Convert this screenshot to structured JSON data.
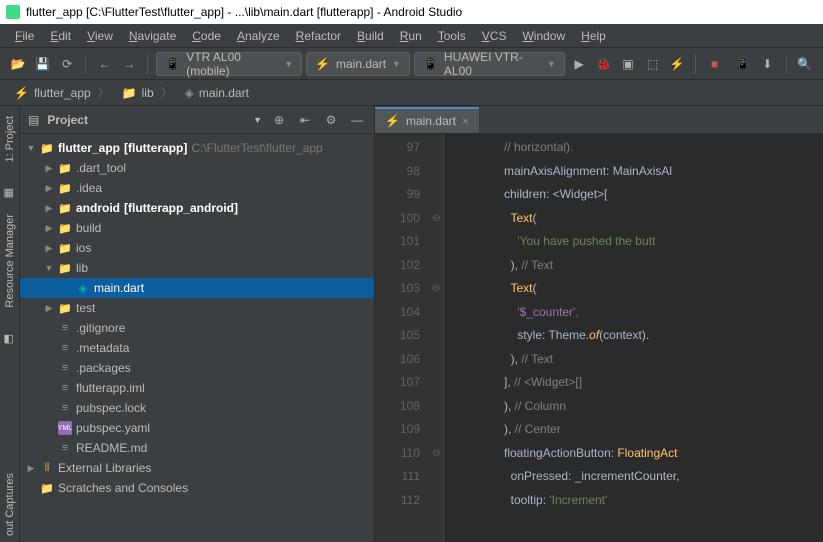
{
  "title": "flutter_app [C:\\FlutterTest\\flutter_app] - ...\\lib\\main.dart [flutterapp] - Android Studio",
  "menu": [
    "File",
    "Edit",
    "View",
    "Navigate",
    "Code",
    "Analyze",
    "Refactor",
    "Build",
    "Run",
    "Tools",
    "VCS",
    "Window",
    "Help"
  ],
  "toolbar": {
    "device": "VTR AL00 (mobile)",
    "config": "main.dart",
    "target": "HUAWEI VTR-AL00"
  },
  "breadcrumbs": [
    {
      "icon": "flutter",
      "label": "flutter_app"
    },
    {
      "icon": "folder",
      "label": "lib"
    },
    {
      "icon": "dart",
      "label": "main.dart"
    }
  ],
  "leftTabs": [
    "1: Project",
    "Resource Manager",
    "out Captures"
  ],
  "panel": {
    "title": "Project"
  },
  "tree": [
    {
      "d": 0,
      "a": "▼",
      "i": "folder-b",
      "t": "flutter_app",
      "suf": "[flutterapp]",
      "dim": "C:\\FlutterTest\\flutter_app"
    },
    {
      "d": 1,
      "a": "▶",
      "i": "folder-o",
      "t": ".dart_tool"
    },
    {
      "d": 1,
      "a": "▶",
      "i": "folder",
      "t": ".idea"
    },
    {
      "d": 1,
      "a": "▶",
      "i": "folder-b",
      "t": "android",
      "suf": "[flutterapp_android]"
    },
    {
      "d": 1,
      "a": "▶",
      "i": "folder-g",
      "t": "build"
    },
    {
      "d": 1,
      "a": "▶",
      "i": "folder-b",
      "t": "ios"
    },
    {
      "d": 1,
      "a": "▼",
      "i": "folder-b",
      "t": "lib"
    },
    {
      "d": 2,
      "a": "",
      "i": "dart",
      "t": "main.dart",
      "sel": true
    },
    {
      "d": 1,
      "a": "▶",
      "i": "folder-b",
      "t": "test"
    },
    {
      "d": 1,
      "a": "",
      "i": "txt",
      "t": ".gitignore"
    },
    {
      "d": 1,
      "a": "",
      "i": "txt",
      "t": ".metadata"
    },
    {
      "d": 1,
      "a": "",
      "i": "txt",
      "t": ".packages"
    },
    {
      "d": 1,
      "a": "",
      "i": "txt",
      "t": "flutterapp.iml"
    },
    {
      "d": 1,
      "a": "",
      "i": "txt",
      "t": "pubspec.lock"
    },
    {
      "d": 1,
      "a": "",
      "i": "yaml",
      "t": "pubspec.yaml"
    },
    {
      "d": 1,
      "a": "",
      "i": "txt",
      "t": "README.md"
    },
    {
      "d": 0,
      "a": "▶",
      "i": "lib",
      "t": "External Libraries"
    },
    {
      "d": 0,
      "a": "",
      "i": "folder",
      "t": "Scratches and Consoles"
    }
  ],
  "tab": {
    "label": "main.dart"
  },
  "gutterStart": 97,
  "gutterEnd": 112,
  "code": [
    [
      {
        "c": "c-cm",
        "t": "// horizontal)."
      }
    ],
    [
      {
        "c": "c-id",
        "t": "mainAxisAlignment: MainAxisAl"
      }
    ],
    [
      {
        "c": "c-id",
        "t": "children: <Widget>["
      }
    ],
    [
      {
        "c": "c-ty",
        "t": "  Text"
      },
      {
        "c": "c-id",
        "t": "("
      }
    ],
    [
      {
        "c": "c-st",
        "t": "    'You have pushed the butt"
      }
    ],
    [
      {
        "c": "c-id",
        "t": "  ), "
      },
      {
        "c": "c-cm",
        "t": "// Text"
      }
    ],
    [
      {
        "c": "c-ty",
        "t": "  Text"
      },
      {
        "c": "c-id",
        "t": "("
      }
    ],
    [
      {
        "c": "c-st",
        "t": "    '"
      },
      {
        "c": "c-vi",
        "t": "$_counter"
      },
      {
        "c": "c-st",
        "t": "',"
      }
    ],
    [
      {
        "c": "c-id",
        "t": "    style: Theme."
      },
      {
        "c": "c-fn",
        "t": "of"
      },
      {
        "c": "c-id",
        "t": "(context)."
      }
    ],
    [
      {
        "c": "c-id",
        "t": "  ), "
      },
      {
        "c": "c-cm",
        "t": "// Text"
      }
    ],
    [
      {
        "c": "c-id",
        "t": "], "
      },
      {
        "c": "c-cm",
        "t": "// <Widget>[]"
      }
    ],
    [
      {
        "c": "c-id",
        "t": "), "
      },
      {
        "c": "c-cm",
        "t": "// Column"
      }
    ],
    [
      {
        "c": "c-id",
        "t": "), "
      },
      {
        "c": "c-cm",
        "t": "// Center"
      }
    ],
    [
      {
        "c": "c-id",
        "t": "floatingActionButton: "
      },
      {
        "c": "c-ty",
        "t": "FloatingAct"
      }
    ],
    [
      {
        "c": "c-id",
        "t": "  onPressed: _incrementCounter,"
      }
    ],
    [
      {
        "c": "c-id",
        "t": "  tooltip: "
      },
      {
        "c": "c-st",
        "t": "'Increment'"
      }
    ]
  ],
  "folds": [
    "",
    "",
    "",
    "⊖",
    "",
    "",
    "⊖",
    "",
    "",
    "",
    "",
    "",
    "",
    "⊖",
    "",
    ""
  ]
}
